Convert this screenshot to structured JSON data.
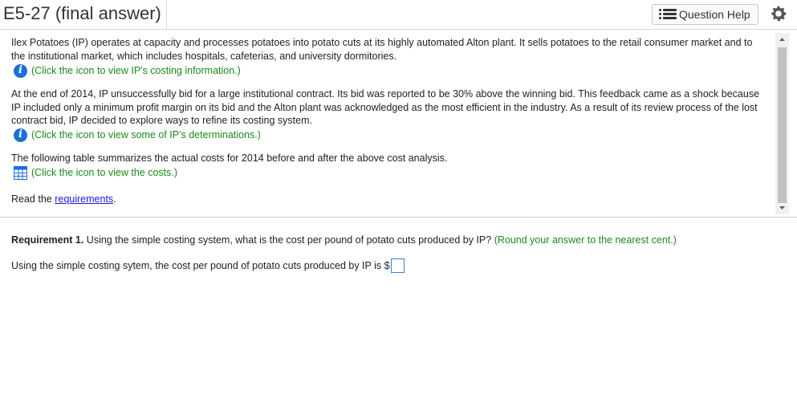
{
  "header": {
    "title": "E5-27 (final answer)",
    "question_help": "Question Help"
  },
  "problem": {
    "para1": "Ilex Potatoes (IP) operates at capacity and processes potatoes into potato cuts at its highly automated Alton plant. It sells potatoes to the retail consumer market and to the institutional market, which includes hospitals, cafeterias, and university dormitories.",
    "info1": "(Click the icon to view IP's costing information.)",
    "para2": "At the end of 2014, IP unsuccessfully bid for a large institutional contract. Its bid was reported to be 30% above the winning bid. This feedback came as a shock because IP included only a minimum profit margin on its bid and the Alton plant was acknowledged as the most efficient in the industry. As a result of its review process of the lost contract bid, IP decided to explore ways to refine its costing system.",
    "info2": "(Click the icon to view some of IP's determinations.)",
    "para3": "The following table summarizes the actual costs for 2014 before and after the above cost analysis.",
    "info3": "(Click the icon to view the costs.)",
    "read_prefix": "Read the ",
    "read_link": "requirements",
    "read_suffix": "."
  },
  "requirement": {
    "label": "Requirement 1.",
    "text": " Using the simple costing system, what is the cost per pound of potato cuts produced by IP? ",
    "hint": "(Round your answer to the nearest cent.)",
    "answer_prefix": "Using the simple costing sytem, the cost per pound of potato cuts produced by IP is $",
    "answer_value": ""
  },
  "colors": {
    "accent_green": "#1a8a1a",
    "info_blue": "#1b6fd6",
    "link_blue": "#1a1ae0"
  }
}
